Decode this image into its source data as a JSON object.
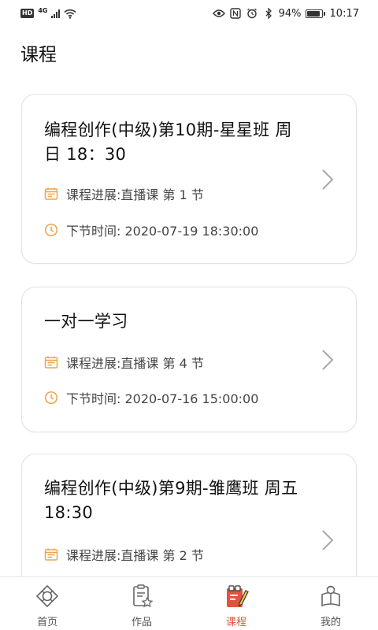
{
  "status_bar": {
    "hd": "HD",
    "network": "4G",
    "battery": "94%",
    "battery_level": 0.94,
    "time": "10:17"
  },
  "page_title": "课程",
  "courses": [
    {
      "title": "编程创作(中级)第10期-星星班 周日  18：30",
      "progress": "课程进展:直播课 第 1 节",
      "next_time": "下节时间: 2020-07-19 18:30:00"
    },
    {
      "title": "一对一学习",
      "progress": "课程进展:直播课 第 4 节",
      "next_time": "下节时间: 2020-07-16 15:00:00"
    },
    {
      "title": "编程创作(中级)第9期-雏鹰班 周五  18:30",
      "progress": "课程进展:直播课 第 2 节"
    }
  ],
  "tabs": [
    {
      "label": "首页",
      "icon": "home-icon"
    },
    {
      "label": "作品",
      "icon": "works-icon"
    },
    {
      "label": "课程",
      "icon": "course-icon",
      "active": true
    },
    {
      "label": "我的",
      "icon": "profile-icon"
    }
  ],
  "colors": {
    "accent": "#e0533e",
    "icon_orange": "#e8a54a"
  }
}
